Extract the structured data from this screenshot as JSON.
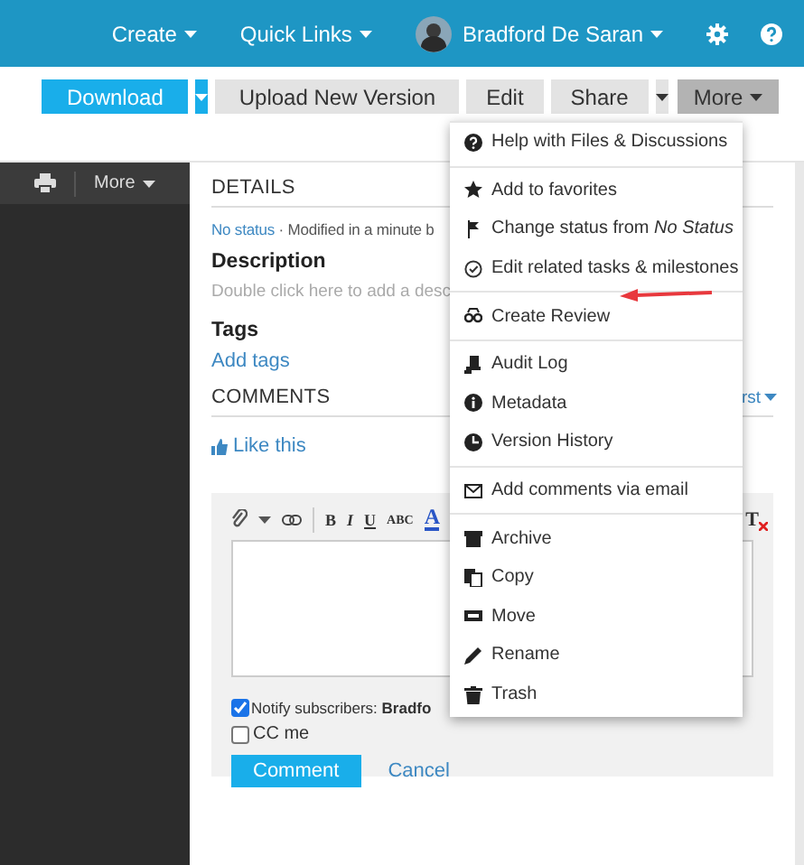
{
  "top_bar": {
    "links": [
      "Create",
      "Quick Links"
    ],
    "user_name": "Bradford De Saran"
  },
  "actions": [
    {
      "kind": "primary",
      "label": "Download"
    },
    {
      "kind": "primary-caret"
    },
    {
      "kind": "secondary",
      "label": "Upload New Version"
    },
    {
      "kind": "secondary",
      "label": "Edit"
    },
    {
      "kind": "secondary",
      "label": "Share"
    },
    {
      "kind": "secondary-caret"
    }
  ],
  "more_button": {
    "label": "More",
    "expanded": true
  },
  "sidebar": {
    "more_label": "More"
  },
  "details": {
    "heading": "DETAILS",
    "status_link": "No status",
    "modified": "· Modified in a minute b",
    "description_heading": "Description",
    "description_placeholder": "Double click here to add a desc",
    "tags_heading": "Tags",
    "tags_link": "Add tags",
    "comments_heading": "COMMENTS",
    "sort_label": "rst",
    "like": "Like this"
  },
  "editor": {
    "tools": [
      "B",
      "I",
      "U",
      "ABC",
      "A"
    ],
    "clear_format": "T"
  },
  "comment_form": {
    "notify": {
      "label": "Notify subscribers: **Bradfo**",
      "checked": true
    },
    "cc": {
      "label": "CC me",
      "checked": false
    },
    "submit": "Comment",
    "cancel": "Cancel"
  },
  "menu": {
    "sections": [
      [
        "Help with Files & Discussions"
      ],
      [
        "Add to favorites",
        "Change status from *No Status*",
        "Edit related tasks & milestones"
      ],
      [
        "Create Review"
      ],
      [
        "Audit Log",
        "Metadata",
        "Version History"
      ],
      [
        "Add comments via email"
      ],
      [
        "Archive",
        "Copy",
        "Move",
        "Rename",
        "Trash"
      ]
    ]
  }
}
